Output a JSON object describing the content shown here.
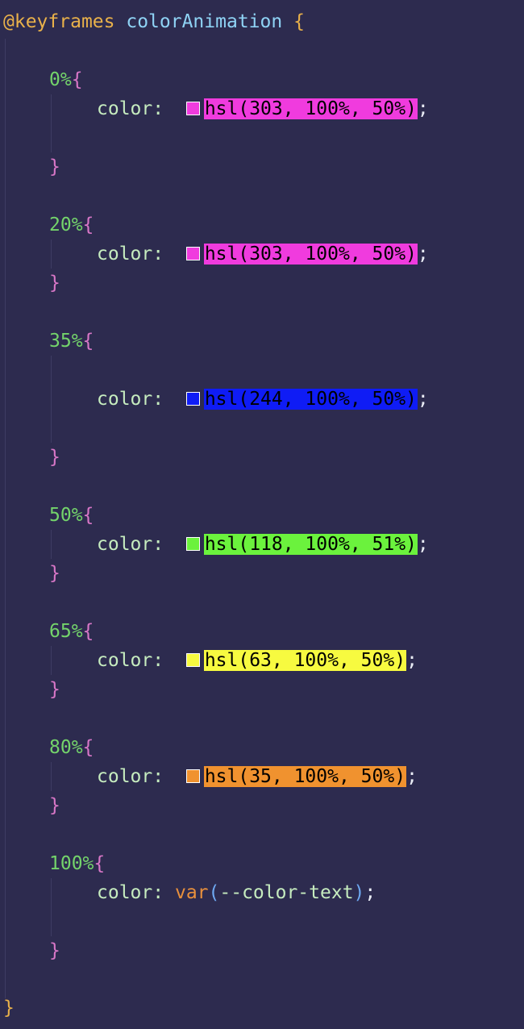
{
  "rule": {
    "at": "@",
    "keyword": "keyframes",
    "name": "colorAnimation",
    "open_brace": "{",
    "close_brace": "}"
  },
  "frames": [
    {
      "pct": "0%",
      "prop": "color",
      "value": "hsl(303, 100%, 50%)",
      "color": "#f03bde"
    },
    {
      "pct": "20%",
      "prop": "color",
      "value": "hsl(303, 100%, 50%)",
      "color": "#f03bde"
    },
    {
      "pct": "35%",
      "prop": "color",
      "value": "hsl(244, 100%, 50%)",
      "color": "#0f1cf5"
    },
    {
      "pct": "50%",
      "prop": "color",
      "value": "hsl(118, 100%, 51%)",
      "color": "#6bf23d"
    },
    {
      "pct": "65%",
      "prop": "color",
      "value": "hsl(63, 100%, 50%)",
      "color": "#f7fa40"
    },
    {
      "pct": "80%",
      "prop": "color",
      "value": "hsl(35, 100%, 50%)",
      "color": "#f0922f"
    }
  ],
  "last_frame": {
    "pct": "100%",
    "prop": "color",
    "fn": "var",
    "arg": "--color-text"
  },
  "punct": {
    "open": "{",
    "close": "}",
    "colon": ":",
    "semi": ";",
    "lparen": "(",
    "rparen": ")"
  }
}
